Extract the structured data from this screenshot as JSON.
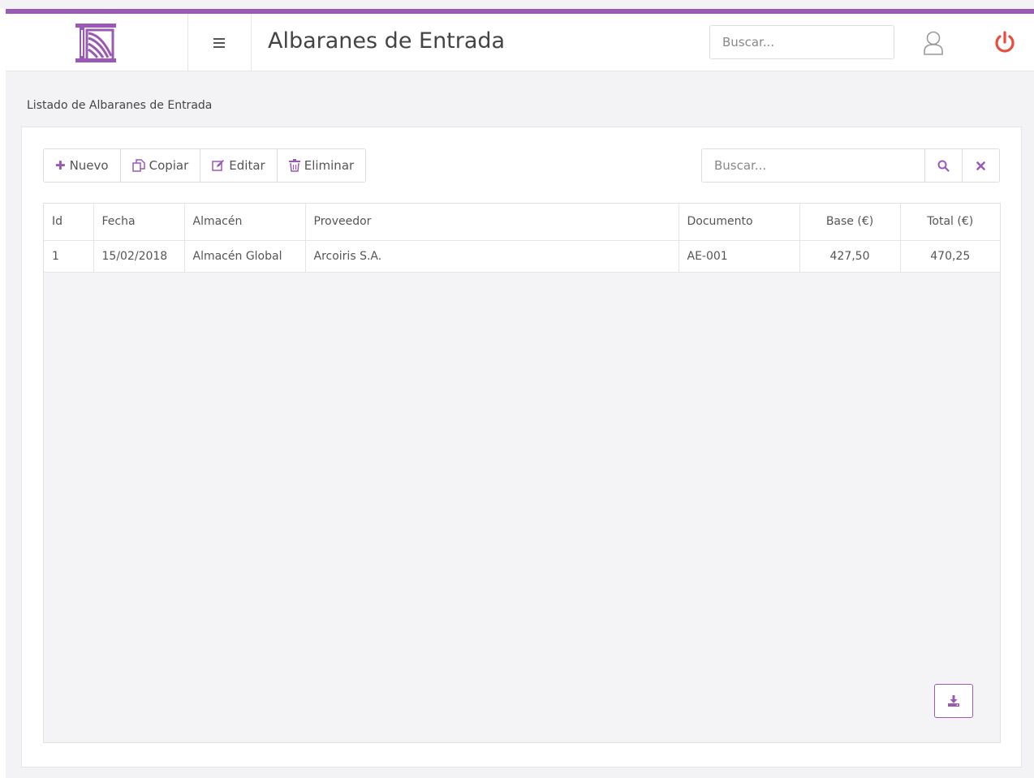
{
  "header": {
    "title": "Albaranes de Entrada",
    "search_placeholder": "Buscar..."
  },
  "icons": {
    "logo": "logo-columns",
    "menu": "hamburger-icon",
    "user": "user-icon",
    "power": "power-icon"
  },
  "colors": {
    "accent": "#9b59b6",
    "power": "#e74c3c"
  },
  "list": {
    "title": "Listado de Albaranes de Entrada",
    "toolbar": {
      "new_label": "Nuevo",
      "copy_label": "Copiar",
      "edit_label": "Editar",
      "delete_label": "Eliminar"
    },
    "search_placeholder": "Buscar...",
    "columns": [
      "Id",
      "Fecha",
      "Almacén",
      "Proveedor",
      "Documento",
      "Base (€)",
      "Total (€)"
    ],
    "rows": [
      [
        "1",
        "15/02/2018",
        "Almacén Global",
        "Arcoiris S.A.",
        "AE-001",
        "427,50",
        "470,25"
      ]
    ]
  }
}
